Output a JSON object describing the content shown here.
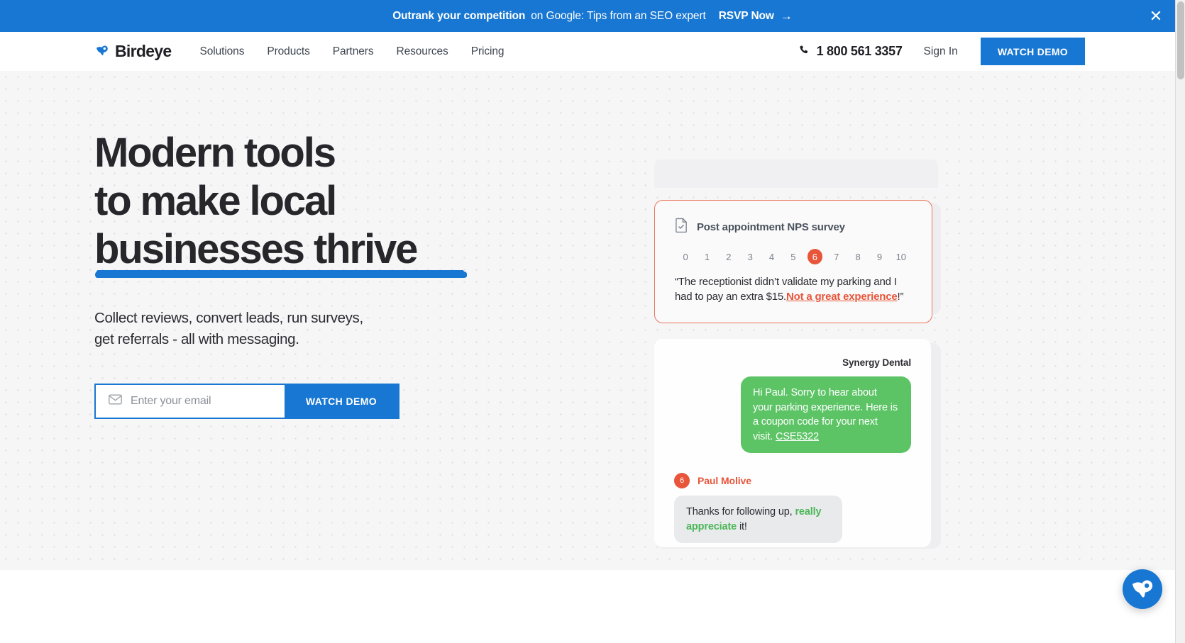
{
  "banner": {
    "strong": "Outrank your competition",
    "rest": "on Google: Tips from an SEO expert",
    "cta": "RSVP Now",
    "arrow": "→",
    "close": "✕",
    "bg_color": "#1877d2"
  },
  "header": {
    "brand": "Birdeye",
    "nav": [
      {
        "label": "Solutions"
      },
      {
        "label": "Products"
      },
      {
        "label": "Partners"
      },
      {
        "label": "Resources"
      },
      {
        "label": "Pricing"
      }
    ],
    "phone": "1 800 561 3357",
    "signin": "Sign In",
    "demo_button": "WATCH DEMO"
  },
  "hero": {
    "headline_line1": "Modern tools",
    "headline_line2": "to make local",
    "headline_line3": "businesses thrive",
    "subhead_line1": "Collect reviews, convert leads, run surveys,",
    "subhead_line2": "get referrals - all with messaging.",
    "underline_color": "#1877d2",
    "email_placeholder": "Enter your email",
    "email_value": "",
    "form_button": "WATCH DEMO"
  },
  "nps_card": {
    "title": "Post appointment NPS survey",
    "scale": [
      "0",
      "1",
      "2",
      "3",
      "4",
      "5",
      "6",
      "7",
      "8",
      "9",
      "10"
    ],
    "selected": "6",
    "quote_open": "“The receptionist didn’t validate my parking and I had to pay an extra $15.",
    "quote_highlight": "Not a great experience",
    "quote_close": "!”",
    "border_color": "#e8755a",
    "accent_color": "#e8553a"
  },
  "chat_card": {
    "business": "Synergy Dental",
    "outgoing_text": "Hi Paul. Sorry to hear about your parking experience. Here is a coupon code for your next visit.",
    "coupon_code": "CSE5322",
    "user_name": "Paul Molive",
    "user_score": "6",
    "incoming_prefix": "Thanks for following up,",
    "incoming_highlight": "really appreciate",
    "incoming_suffix": "it!",
    "bubble_out_color": "#5dc466",
    "bubble_in_color": "#e9eaec"
  },
  "widget": {
    "label": "birdeye-chat-widget",
    "color": "#1877d2"
  }
}
